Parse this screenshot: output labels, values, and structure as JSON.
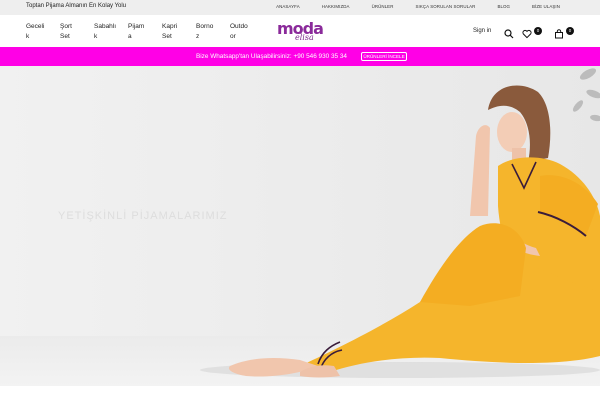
{
  "topbar": {
    "tagline": "Toptan Pijama Almanın En Kolay Yolu",
    "links": [
      "ANASAYFA",
      "HAKKIMIZDA",
      "ÜRÜNLER",
      "SIKÇA SORULAN SORULAR",
      "BLOG",
      "BİZE ULAŞIN"
    ]
  },
  "nav": {
    "items": [
      {
        "line1": "Geceli",
        "line2": "k"
      },
      {
        "line1": "Şort",
        "line2": "Set"
      },
      {
        "line1": "Sabahlı",
        "line2": "k"
      },
      {
        "line1": "Pijam",
        "line2": "a"
      },
      {
        "line1": "Kapri",
        "line2": "Set"
      },
      {
        "line1": "Borno",
        "line2": "z"
      },
      {
        "line1": "Outdo",
        "line2": "or"
      }
    ]
  },
  "logo": {
    "brand": "moda",
    "sub": "elisa"
  },
  "header": {
    "signin": "Sign in",
    "wishlist_count": "0",
    "cart_count": "0"
  },
  "promo": {
    "text": "Bize Whatsapp'tan Ulaşabilirsiniz: +90 546 930 35 34",
    "button": "ÜRÜNLERİ İNCELE"
  },
  "hero": {
    "headline": "YETİŞKİNLİ PİJAMALARIMIZ"
  },
  "colors": {
    "promo_bg": "#ff00e6",
    "pajama": "#f5b52c",
    "brand_purple": "#8a2a9a",
    "brand_pink": "#e6197e"
  }
}
